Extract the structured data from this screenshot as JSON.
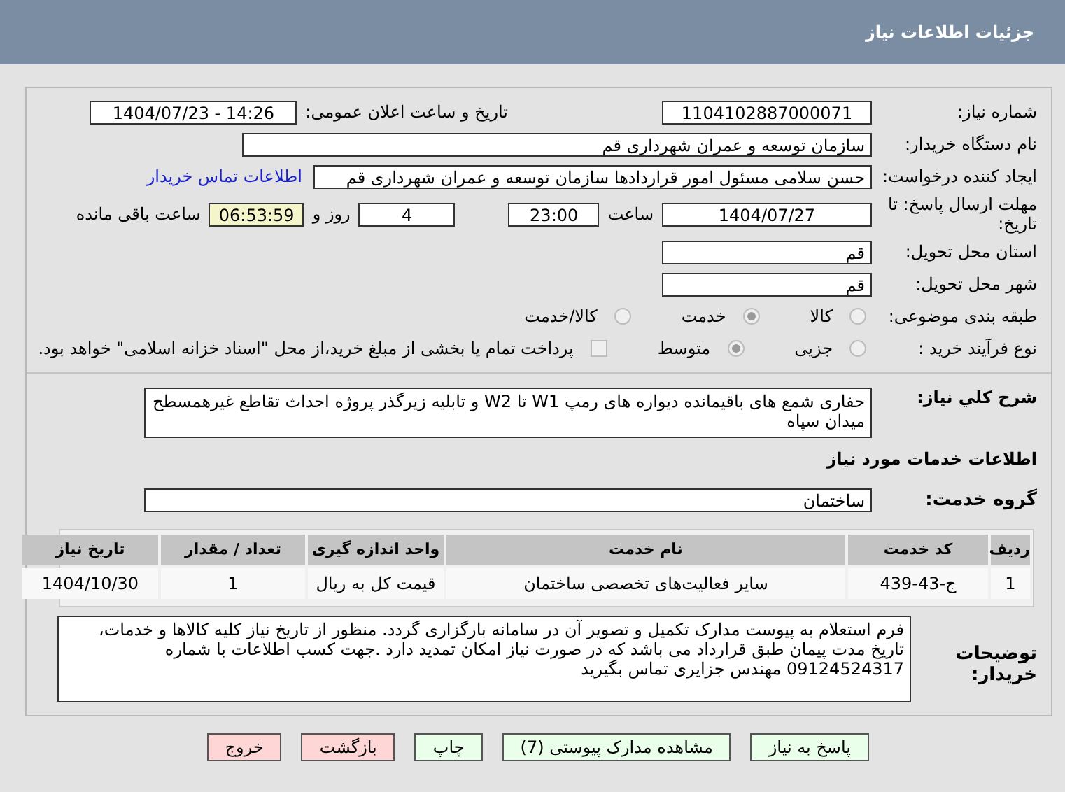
{
  "header": {
    "title": "جزئیات اطلاعات نیاز"
  },
  "need_number": {
    "label": "شماره نیاز:",
    "value": "1104102887000071"
  },
  "announce": {
    "label": "تاریخ و ساعت اعلان عمومی:",
    "value": "1404/07/23 - 14:26"
  },
  "buyer": {
    "label": "نام دستگاه خریدار:",
    "value": "سازمان توسعه و عمران شهرداری قم"
  },
  "creator": {
    "label": "ایجاد کننده درخواست:",
    "value": "حسن سلامی مسئول امور قراردادها سازمان توسعه و عمران شهرداری قم",
    "link": "اطلاعات تماس خریدار"
  },
  "deadline": {
    "label": "مهلت ارسال پاسخ: تا تاریخ:",
    "date": "1404/07/27",
    "time_label": "ساعت",
    "time": "23:00",
    "days": "4",
    "days_label": "روز و",
    "remaining": "06:53:59",
    "remaining_label": "ساعت باقی مانده"
  },
  "province": {
    "label": "استان محل تحویل:",
    "value": "قم"
  },
  "city": {
    "label": "شهر محل تحویل:",
    "value": "قم"
  },
  "category": {
    "label": "طبقه بندی موضوعی:",
    "options": [
      {
        "label": "کالا",
        "selected": false
      },
      {
        "label": "خدمت",
        "selected": true
      },
      {
        "label": "کالا/خدمت",
        "selected": false
      }
    ]
  },
  "process": {
    "label": "نوع فرآیند خرید :",
    "options": [
      {
        "label": "جزیی",
        "selected": false
      },
      {
        "label": "متوسط",
        "selected": true
      }
    ],
    "payment": {
      "checked": false,
      "label": "پرداخت تمام یا بخشی از مبلغ خرید،از محل \"اسناد خزانه اسلامی\" خواهد بود."
    }
  },
  "description": {
    "label": "شرح کلي نياز:",
    "value": "حفاری شمع های باقیمانده دیواره های رمپ W1 تا W2 و تابلیه زیرگذر پروژه احداث تقاطع غیرهمسطح میدان سپاه"
  },
  "services_heading": "اطلاعات خدمات مورد نیاز",
  "service_group": {
    "label": "گروه خدمت:",
    "value": "ساختمان"
  },
  "table": {
    "columns": [
      "ردیف",
      "کد خدمت",
      "نام خدمت",
      "واحد اندازه گیری",
      "تعداد / مقدار",
      "تاریخ نیاز"
    ],
    "rows": [
      [
        "1",
        "ج-43-439",
        "سایر فعالیت‌های تخصصی ساختمان",
        "قیمت کل به ریال",
        "1",
        "1404/10/30"
      ]
    ]
  },
  "notes": {
    "label": "توضیحات خریدار:",
    "value": "فرم استعلام به پیوست مدارک تکمیل و تصویر آن در سامانه بارگزاری گردد. منظور از تاریخ نیاز کلیه کالاها و خدمات، تاریخ مدت پیمان طبق قرارداد می باشد که در صورت نیاز امکان تمدید دارد .جهت کسب اطلاعات با شماره 09124524317 مهندس جزایری تماس بگیرید"
  },
  "buttons": [
    {
      "label": "پاسخ به نیاز",
      "kind": "primary"
    },
    {
      "label": "مشاهده مدارک پیوستی (7)",
      "kind": "primary"
    },
    {
      "label": "چاپ",
      "kind": "primary"
    },
    {
      "label": "بازگشت",
      "kind": "danger"
    },
    {
      "label": "خروج",
      "kind": "danger"
    }
  ]
}
